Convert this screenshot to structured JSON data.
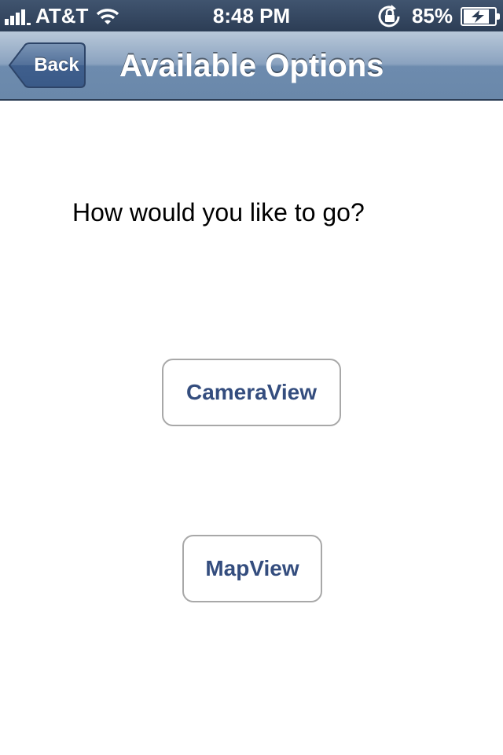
{
  "status_bar": {
    "carrier": "AT&T",
    "time": "8:48 PM",
    "battery_percent": "85%",
    "signal_bars": 4,
    "icons": [
      "signal-icon",
      "wifi-icon",
      "rotation-lock-icon",
      "battery-charging-icon"
    ]
  },
  "nav": {
    "back_label": "Back",
    "title": "Available Options"
  },
  "main": {
    "question": "How would you like to go?",
    "camera_button_label": "CameraView",
    "map_button_label": "MapView"
  },
  "colors": {
    "status_bar": "#2c3d55",
    "nav_bar": "#8aa2bf",
    "button_text": "#344d7e",
    "button_border": "#a8a8a8"
  }
}
